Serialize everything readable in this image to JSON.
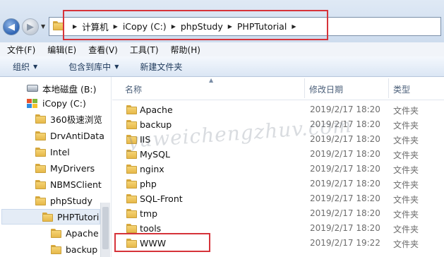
{
  "address": {
    "crumbs": [
      "计算机",
      "iCopy (C:)",
      "phpStudy",
      "PHPTutorial"
    ]
  },
  "menu": [
    "文件(F)",
    "编辑(E)",
    "查看(V)",
    "工具(T)",
    "帮助(H)"
  ],
  "toolbar": {
    "organize": "组织",
    "include_library": "包含到库中",
    "new_folder": "新建文件夹"
  },
  "nav": [
    {
      "label": "本地磁盘 (B:)",
      "icon": "drive-icon"
    },
    {
      "label": "iCopy (C:)",
      "icon": "windows-drive-icon"
    },
    {
      "label": "360极速浏览",
      "icon": "folder-icon"
    },
    {
      "label": "DrvAntiData",
      "icon": "folder-icon"
    },
    {
      "label": "Intel",
      "icon": "folder-icon"
    },
    {
      "label": "MyDrivers",
      "icon": "folder-icon"
    },
    {
      "label": "NBMSClient",
      "icon": "folder-icon"
    },
    {
      "label": "phpStudy",
      "icon": "folder-icon"
    },
    {
      "label": "PHPTutorial",
      "icon": "folder-icon",
      "selected": true
    },
    {
      "label": "Apache",
      "icon": "folder-icon"
    },
    {
      "label": "backup",
      "icon": "folder-icon"
    }
  ],
  "columns": {
    "name": "名称",
    "modified": "修改日期",
    "type": "类型"
  },
  "files": [
    {
      "name": "Apache",
      "modified": "2019/2/17 18:20",
      "type": "文件夹"
    },
    {
      "name": "backup",
      "modified": "2019/2/17 18:20",
      "type": "文件夹"
    },
    {
      "name": "IIS",
      "modified": "2019/2/17 18:20",
      "type": "文件夹"
    },
    {
      "name": "MySQL",
      "modified": "2019/2/17 18:20",
      "type": "文件夹"
    },
    {
      "name": "nginx",
      "modified": "2019/2/17 18:20",
      "type": "文件夹"
    },
    {
      "name": "php",
      "modified": "2019/2/17 18:20",
      "type": "文件夹"
    },
    {
      "name": "SQL-Front",
      "modified": "2019/2/17 18:20",
      "type": "文件夹"
    },
    {
      "name": "tmp",
      "modified": "2019/2/17 18:20",
      "type": "文件夹"
    },
    {
      "name": "tools",
      "modified": "2019/2/17 18:20",
      "type": "文件夹"
    },
    {
      "name": "WWW",
      "modified": "2019/2/17 19:22",
      "type": "文件夹"
    }
  ],
  "watermark": "yuweichengzhuv.com",
  "colors": {
    "highlight": "#d6333a",
    "accent": "#1e395b"
  }
}
